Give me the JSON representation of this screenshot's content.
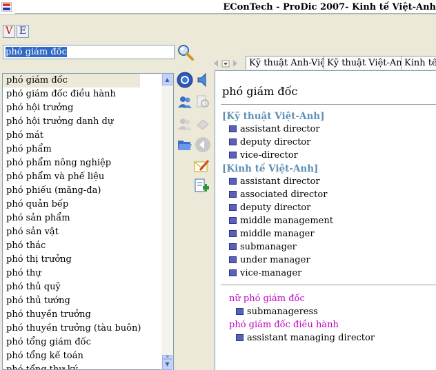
{
  "window": {
    "title": "EConTech - ProDic 2007- Kinh tế Việt-Anh"
  },
  "lang_buttons": [
    "V",
    "E"
  ],
  "search": {
    "value": "phó giám đốc"
  },
  "word_list": [
    "phó giám đốc",
    "phó giám đốc điều hành",
    "phó hội trưởng",
    "phó hội trưởng danh dự",
    "phó mát",
    "phó phẩm",
    "phó phẩm nông nghiệp",
    "phó phẩm và phế liệu",
    "phó phiếu (măng-đa)",
    "phó quản bếp",
    "phó sản phẩm",
    "phó sản vật",
    "phó thác",
    "phó thị trưởng",
    "phó thự",
    "phó thủ quỹ",
    "phó thủ tướng",
    "phó thuyền trưởng",
    "phó thuyền trưởng (tàu buôn)",
    "phó tổng giám đốc",
    "phó tổng kế toán",
    "phó tổng thư ký"
  ],
  "dict_tabs": [
    "Kỹ thuật Anh-Việt",
    "Kỹ thuật Việt-Anh",
    "Kinh tế Anh-Việt"
  ],
  "entry": {
    "headword": "phó giám đốc",
    "sections": [
      {
        "dict": "[Kỹ thuật Việt-Anh]",
        "items": [
          "assistant director",
          "deputy director",
          "vice-director"
        ]
      },
      {
        "dict": "[Kinh tế Việt-Anh]",
        "items": [
          "assistant director",
          "associated director",
          "deputy director",
          "middle management",
          "middle manager",
          "submanager",
          "under manager",
          "vice-manager"
        ]
      }
    ],
    "related": [
      {
        "term": "nữ phó giám đốc",
        "items": [
          "submanageress"
        ]
      },
      {
        "term": "phó giám đốc điều hành",
        "items": [
          "assistant managing director"
        ]
      }
    ]
  },
  "colors": {
    "accent": "#316ac5",
    "section": "#5f8fb5",
    "related": "#c000c0"
  },
  "icons": [
    "app-icon",
    "search-icon",
    "globe-icon",
    "speaker-icon",
    "users-icon",
    "users-disabled-icon",
    "folder-open-icon",
    "back-icon",
    "note-edit-icon",
    "add-page-icon"
  ]
}
